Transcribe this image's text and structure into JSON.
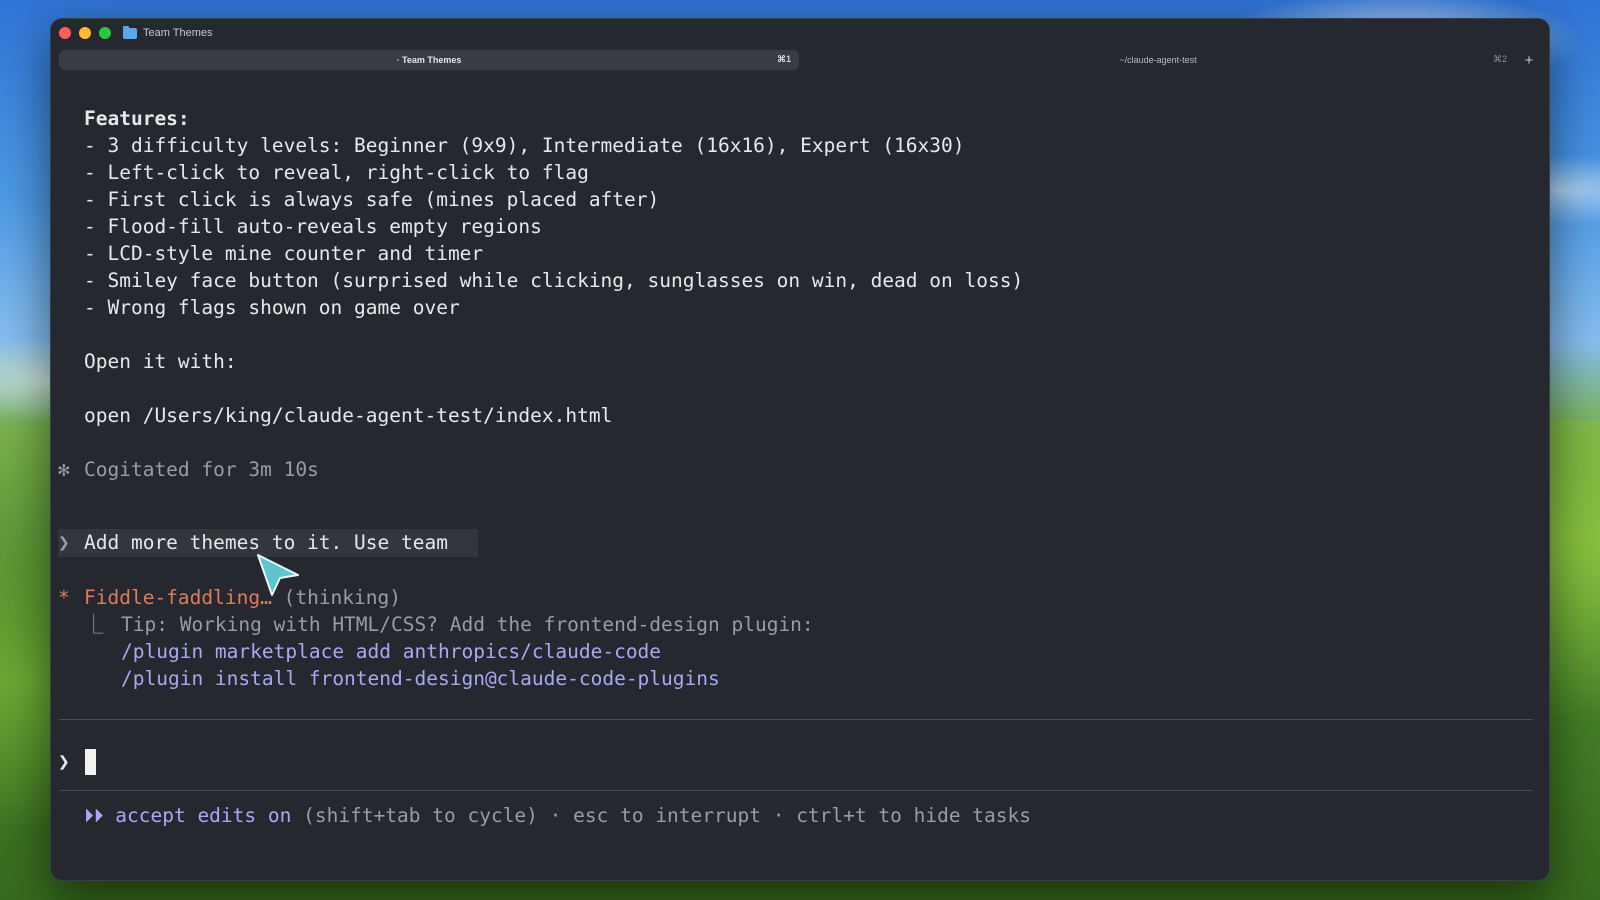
{
  "window": {
    "title": "Team Themes"
  },
  "tabs": [
    {
      "label": "· Team Themes",
      "shortcut": "⌘1",
      "active": true
    },
    {
      "label": "~/claude-agent-test",
      "shortcut": "⌘2",
      "active": false
    }
  ],
  "new_tab_label": "+",
  "output": {
    "features_heading": "Features:",
    "features": [
      "- 3 difficulty levels: Beginner (9x9), Intermediate (16x16), Expert (16x30)",
      "- Left-click to reveal, right-click to flag",
      "- First click is always safe (mines placed after)",
      "- Flood-fill auto-reveals empty regions",
      "- LCD-style mine counter and timer",
      "- Smiley face button (surprised while clicking, sunglasses on win, dead on loss)",
      "- Wrong flags shown on game over"
    ],
    "open_label": "Open it with:",
    "open_command": "open /Users/king/claude-agent-test/index.html"
  },
  "cogitated": {
    "glyph": "✻",
    "text": "Cogitated for 3m 10s"
  },
  "user_prompt": {
    "marker": "❯",
    "text": "Add more themes to it. Use team"
  },
  "status": {
    "glyph": "*",
    "activity": "Fiddle-faddling…",
    "state": "(thinking)"
  },
  "tip": {
    "branch": "⎿",
    "text": "Tip: Working with HTML/CSS? Add the frontend-design plugin:",
    "commands": [
      "/plugin marketplace add anthropics/claude-code",
      "/plugin install frontend-design@claude-code-plugins"
    ]
  },
  "input": {
    "marker": "❯",
    "value": ""
  },
  "footer": {
    "mode_icon": "⏵⏵",
    "mode_label": "accept edits on",
    "hint": " (shift+tab to cycle) · esc to interrupt · ctrl+t to hide tasks"
  },
  "colors": {
    "terminal_bg": "#262830",
    "accent_orange": "#e07a5f",
    "accent_violet": "#a7a9f2",
    "muted_text": "#9a9ca4"
  },
  "icons": [
    "folder-icon",
    "mouse-pointer-icon"
  ]
}
